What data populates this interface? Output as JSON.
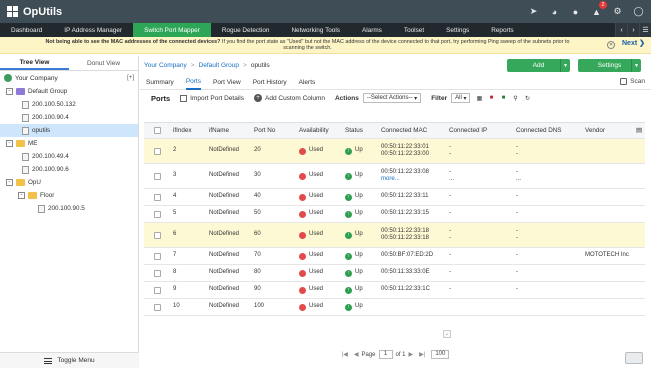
{
  "app": {
    "title": "OpUtils",
    "notif_count": "2"
  },
  "nav": {
    "items": [
      "Dashboard",
      "IP Address Manager",
      "Switch Port Mapper",
      "Rogue Detection",
      "Networking Tools",
      "Alarms",
      "Toolset",
      "Settings",
      "Reports"
    ],
    "active_index": 2
  },
  "banner": {
    "bold": "Not being able to see the MAC addresses of the connected devices?",
    "text": " If you find the port state as \"Used\" but not the MAC address of the device connected to that port, try performing Ping sweep of the subnets prior to scanning the switch.",
    "next": "Next"
  },
  "left": {
    "tab_tree": "Tree View",
    "tab_donut": "Donut View",
    "root": "Your Company",
    "root_ctl": "[+]",
    "nodes": [
      {
        "label": "Default Group",
        "type": "group"
      },
      {
        "label": "200.100.50.132",
        "type": "device"
      },
      {
        "label": "200.100.90.4",
        "type": "device"
      },
      {
        "label": "oputils",
        "type": "device",
        "selected": true
      },
      {
        "label": "ME",
        "type": "group"
      },
      {
        "label": "200.100.49.4",
        "type": "device"
      },
      {
        "label": "200.100.90.6",
        "type": "device"
      },
      {
        "label": "OpU",
        "type": "group"
      },
      {
        "label": "Floor",
        "type": "subgroup"
      },
      {
        "label": "200.100.90.5",
        "type": "subdevice"
      }
    ],
    "toggle_menu": "Toggle Menu"
  },
  "breadcrumb": {
    "a": "Your Company",
    "b": "Default Group",
    "c": "oputils"
  },
  "buttons": {
    "add": "Add",
    "settings": "Settings"
  },
  "subtabs": [
    "Summary",
    "Ports",
    "Port View",
    "Port History",
    "Alerts"
  ],
  "scan": "Scan",
  "toolbar": {
    "title": "Ports",
    "import": "Import Port Details",
    "add_col": "Add Custom Column",
    "actions": "Actions",
    "actions_select": "--Select Actions--",
    "filter": "Filter",
    "filter_value": "All"
  },
  "table": {
    "headers": [
      "ifIndex",
      "ifName",
      "Port No",
      "Availability",
      "Status",
      "Connected MAC",
      "Connected IP",
      "Connected DNS",
      "Vendor"
    ],
    "rows": [
      {
        "ifindex": "2",
        "ifname": "NotDefined",
        "port": "20",
        "avail": "Used",
        "status": "Up",
        "mac": [
          "00:50:11:22:33:01",
          "00:50:11:22:33:00"
        ],
        "ip": [
          "-",
          "-"
        ],
        "dns": [
          "-",
          "-"
        ],
        "vendor": "",
        "hl": true
      },
      {
        "ifindex": "3",
        "ifname": "NotDefined",
        "port": "30",
        "avail": "Used",
        "status": "Up",
        "mac": [
          "00:50:11:22:33:08",
          "more..."
        ],
        "ip": [
          "-",
          "..."
        ],
        "dns": [
          "-",
          "..."
        ],
        "vendor": "",
        "hl": false
      },
      {
        "ifindex": "4",
        "ifname": "NotDefined",
        "port": "40",
        "avail": "Used",
        "status": "Up",
        "mac": [
          "00:50:11:22:33:11"
        ],
        "ip": [
          "-"
        ],
        "dns": [
          "-"
        ],
        "vendor": "",
        "hl": false
      },
      {
        "ifindex": "5",
        "ifname": "NotDefined",
        "port": "50",
        "avail": "Used",
        "status": "Up",
        "mac": [
          "00:50:11:22:33:15"
        ],
        "ip": [
          "-"
        ],
        "dns": [
          "-"
        ],
        "vendor": "",
        "hl": false
      },
      {
        "ifindex": "6",
        "ifname": "NotDefined",
        "port": "60",
        "avail": "Used",
        "status": "Up",
        "mac": [
          "00:50:11:22:33:18",
          "00:50:11:22:33:18"
        ],
        "ip": [
          "-",
          "-"
        ],
        "dns": [
          "-",
          "-"
        ],
        "vendor": "",
        "hl": true
      },
      {
        "ifindex": "7",
        "ifname": "NotDefined",
        "port": "70",
        "avail": "Used",
        "status": "Up",
        "mac": [
          "00:50:BF:07:ED:2D"
        ],
        "ip": [
          "-"
        ],
        "dns": [
          "-"
        ],
        "vendor": "MOTOTECH Inc",
        "hl": false
      },
      {
        "ifindex": "8",
        "ifname": "NotDefined",
        "port": "80",
        "avail": "Used",
        "status": "Up",
        "mac": [
          "00:50:11:33:33:0E"
        ],
        "ip": [
          "-"
        ],
        "dns": [
          "-"
        ],
        "vendor": "",
        "hl": false
      },
      {
        "ifindex": "9",
        "ifname": "NotDefined",
        "port": "90",
        "avail": "Used",
        "status": "Up",
        "mac": [
          "00:50:11:22:33:1C"
        ],
        "ip": [
          "-"
        ],
        "dns": [
          "-"
        ],
        "vendor": "",
        "hl": false
      },
      {
        "ifindex": "10",
        "ifname": "NotDefined",
        "port": "100",
        "avail": "Used",
        "status": "Up",
        "mac": [],
        "ip": [],
        "dns": [],
        "vendor": "",
        "hl": false
      }
    ]
  },
  "pager": {
    "page_label": "Page",
    "page": "1",
    "of": "of 1",
    "size": "100"
  }
}
